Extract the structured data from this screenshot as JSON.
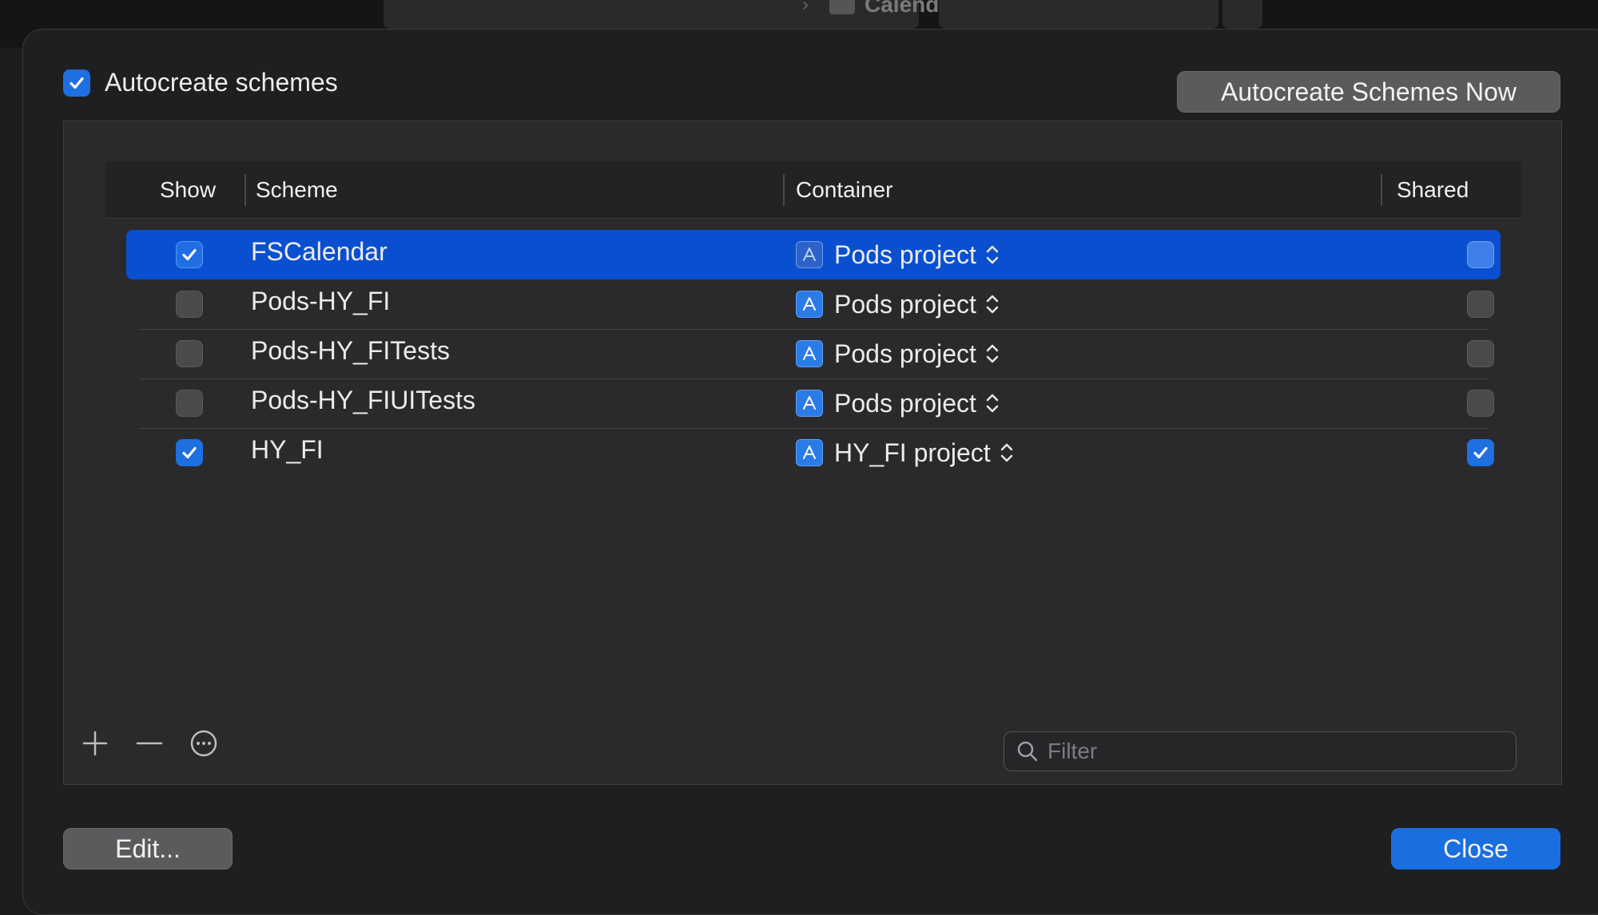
{
  "background": {
    "window_label": "Calendar"
  },
  "sheet": {
    "autocreate": {
      "label": "Autocreate schemes",
      "checked": true
    },
    "autocreate_now_button": "Autocreate Schemes Now",
    "table": {
      "columns": {
        "show": "Show",
        "scheme": "Scheme",
        "container": "Container",
        "shared": "Shared"
      },
      "rows": [
        {
          "show": true,
          "scheme": "FSCalendar",
          "container": "Pods project",
          "shared": false,
          "selected": true
        },
        {
          "show": false,
          "scheme": "Pods-HY_FI",
          "container": "Pods project",
          "shared": false,
          "selected": false
        },
        {
          "show": false,
          "scheme": "Pods-HY_FITests",
          "container": "Pods project",
          "shared": false,
          "selected": false
        },
        {
          "show": false,
          "scheme": "Pods-HY_FIUITests",
          "container": "Pods project",
          "shared": false,
          "selected": false
        },
        {
          "show": true,
          "scheme": "HY_FI",
          "container": "HY_FI project",
          "shared": true,
          "selected": false
        }
      ]
    },
    "tools": {
      "add": "plus-icon",
      "remove": "minus-icon",
      "more": "ellipsis-circle-icon"
    },
    "filter": {
      "placeholder": "Filter",
      "value": ""
    },
    "edit_button": "Edit...",
    "close_button": "Close"
  },
  "colors": {
    "accent": "#1a6fe0",
    "selection": "#0a4fcf",
    "sheet_bg": "#1f1f21",
    "panel_bg": "#2a2a2c"
  }
}
